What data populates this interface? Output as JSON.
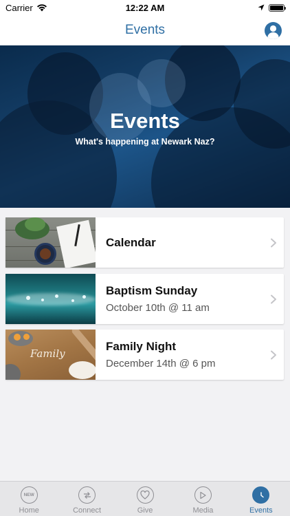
{
  "status_bar": {
    "carrier": "Carrier",
    "time": "12:22 AM"
  },
  "nav": {
    "title": "Events"
  },
  "hero": {
    "title": "Events",
    "subtitle": "What's happening at Newark Naz?"
  },
  "events": [
    {
      "title": "Calendar",
      "subtitle": ""
    },
    {
      "title": "Baptism Sunday",
      "subtitle": "October 10th @ 11 am"
    },
    {
      "title": "Family Night",
      "subtitle": "December 14th @ 6 pm"
    }
  ],
  "tabs": [
    {
      "label": "Home",
      "icon": "new-badge-icon"
    },
    {
      "label": "Connect",
      "icon": "connect-arrows-icon"
    },
    {
      "label": "Give",
      "icon": "heart-icon"
    },
    {
      "label": "Media",
      "icon": "play-icon"
    },
    {
      "label": "Events",
      "icon": "clock-icon",
      "active": true
    }
  ],
  "thumb_badge_text": "NEW",
  "family_thumb_word": "Family",
  "colors": {
    "accent": "#2f6fa4",
    "tab_inactive": "#8e8e93",
    "background": "#f2f2f4"
  }
}
